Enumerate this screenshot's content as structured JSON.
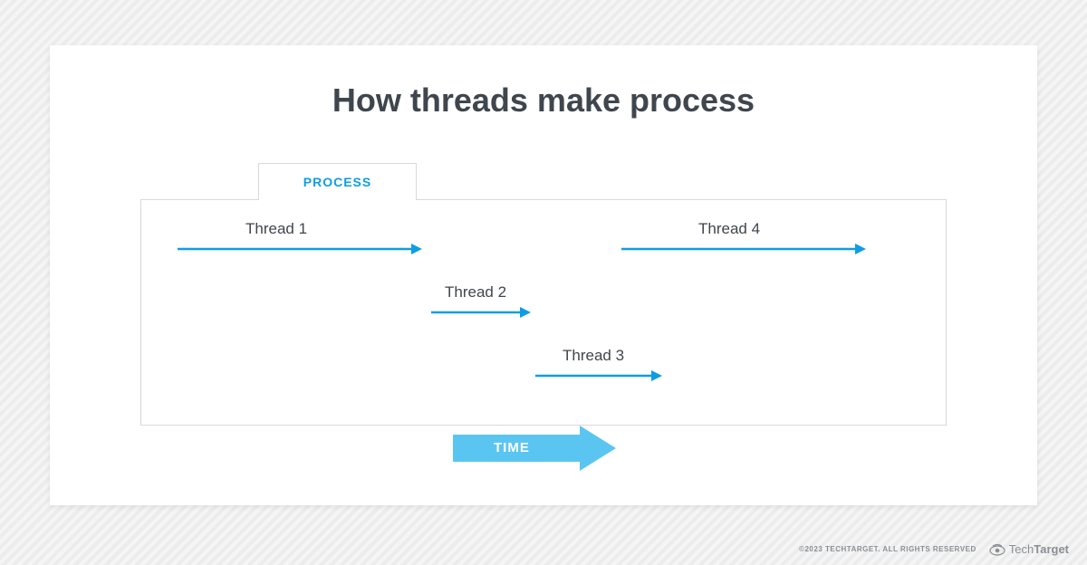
{
  "title": "How threads make process",
  "tab_label": "PROCESS",
  "time_label": "TIME",
  "threads": {
    "t1": "Thread 1",
    "t2": "Thread 2",
    "t3": "Thread 3",
    "t4": "Thread 4"
  },
  "colors": {
    "accent_line": "#0e9de5",
    "time_arrow_fill": "#5bc5f2",
    "title": "#3f464d"
  },
  "footer": {
    "copyright": "©2023 TECHTARGET. ALL RIGHTS RESERVED",
    "logo_light": "Tech",
    "logo_bold": "Target"
  }
}
